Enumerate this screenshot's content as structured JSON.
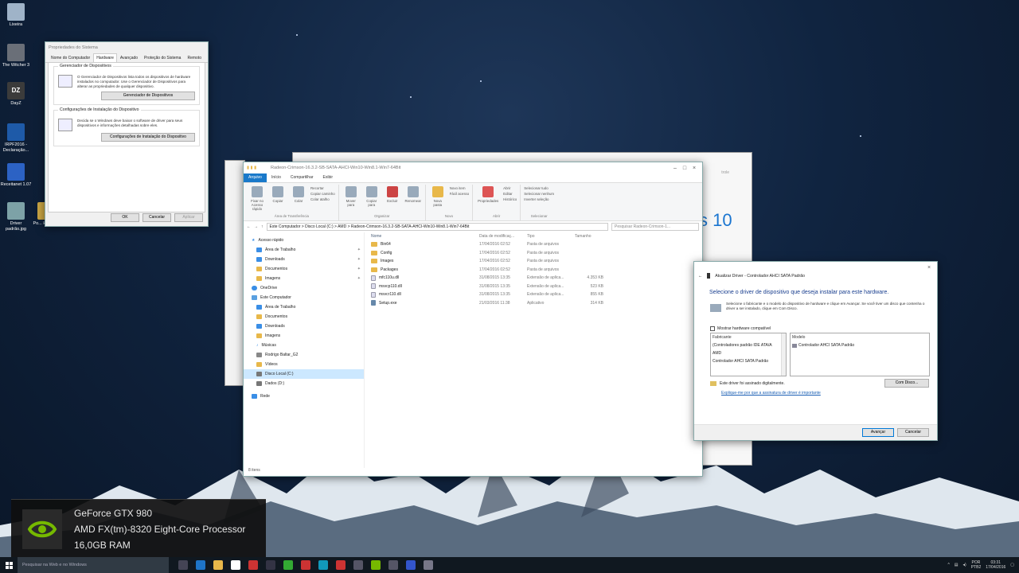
{
  "desktop": {
    "icons": [
      {
        "label": "Lixeira",
        "color": "#9fb3c8"
      },
      {
        "label": "The Witcher 3",
        "color": "#6a6f78"
      },
      {
        "label": "DayZ",
        "color": "#3b3b3b"
      },
      {
        "label": "IRPF2016 - Declaração...",
        "color": "#1e5aa8"
      },
      {
        "label": "Receitanet 1.07",
        "color": "#2c62c4"
      },
      {
        "label": "Driver padrão.jpg",
        "color": "#7da2a7"
      },
      {
        "label": "Po... HDTune",
        "color": "#c9a443"
      }
    ]
  },
  "sysprops": {
    "title": "Propriedades do Sistema",
    "tabs": [
      "Nome do Computador",
      "Hardware",
      "Avançado",
      "Proteção do Sistema",
      "Remoto"
    ],
    "group1_title": "Gerenciador de Dispositivos",
    "group1_text": "O Gerenciador de Dispositivos lista todos os dispositivos de hardware instalados no computador. Use o Gerenciador de Dispositivos para alterar as propriedades de qualquer dispositivo.",
    "group1_button": "Gerenciador de Dispositivos",
    "group2_title": "Configurações de Instalação do Dispositivo",
    "group2_text": "Decida se o Windows deve baixar o software de driver para seus dispositivos e informações detalhadas sobre eles.",
    "group2_button": "Configurações de Instalação do Dispositivo",
    "ok": "OK",
    "cancel": "Cancelar",
    "apply": "Aplicar"
  },
  "explorer": {
    "title": "Radeon-Crimson-16.3.2-SB-SATA-AHCI-Win10-Win8.1-Win7-64Bit",
    "ribbon_tabs": [
      "Arquivo",
      "Início",
      "Compartilhar",
      "Exibir"
    ],
    "groups": {
      "clipboard": {
        "name": "Área de Transferência",
        "pin": "Fixar no Acesso rápido",
        "copy": "Copiar",
        "paste": "Colar",
        "cut": "Recortar",
        "copy_path": "Copiar caminho",
        "paste_shortcut": "Colar atalho"
      },
      "organize": {
        "name": "Organizar",
        "move": "Mover para",
        "copyto": "Copiar para",
        "delete": "Excluir",
        "rename": "Renomear"
      },
      "new": {
        "name": "Novo",
        "folder": "Nova pasta",
        "item": "Novo item",
        "easy": "Fácil acesso"
      },
      "open": {
        "name": "Abrir",
        "props": "Propriedades",
        "open": "Abrir",
        "edit": "Editar",
        "history": "Histórico"
      },
      "select": {
        "name": "Selecionar",
        "all": "Selecionar tudo",
        "none": "Selecionar nenhum",
        "invert": "Inverter seleção"
      }
    },
    "address": "Este Computador  >  Disco Local (C:)  >  AMD  >  Radeon-Crimson-16.3.2-SB-SATA-AHCI-Win10-Win8.1-Win7-64Bit",
    "search_placeholder": "Pesquisar Radeon-Crimson-1...",
    "nav": [
      {
        "label": "Acesso rápido",
        "pinned": false,
        "indent": 0,
        "selected": false
      },
      {
        "label": "Área de Trabalho",
        "pinned": true,
        "indent": 1,
        "selected": false
      },
      {
        "label": "Downloads",
        "pinned": true,
        "indent": 1,
        "selected": false
      },
      {
        "label": "Documentos",
        "pinned": true,
        "indent": 1,
        "selected": false
      },
      {
        "label": "Imagens",
        "pinned": true,
        "indent": 1,
        "selected": false
      },
      {
        "label": "OneDrive",
        "pinned": false,
        "indent": 0,
        "selected": false
      },
      {
        "label": "Este Computador",
        "pinned": false,
        "indent": 0,
        "selected": false
      },
      {
        "label": "Área de Trabalho",
        "pinned": false,
        "indent": 1,
        "selected": false
      },
      {
        "label": "Documentos",
        "pinned": false,
        "indent": 1,
        "selected": false
      },
      {
        "label": "Downloads",
        "pinned": false,
        "indent": 1,
        "selected": false
      },
      {
        "label": "Imagens",
        "pinned": false,
        "indent": 1,
        "selected": false
      },
      {
        "label": "Músicas",
        "pinned": false,
        "indent": 1,
        "selected": false
      },
      {
        "label": "Rodrigo Baltar_G2",
        "pinned": false,
        "indent": 1,
        "selected": false
      },
      {
        "label": "Vídeos",
        "pinned": false,
        "indent": 1,
        "selected": false
      },
      {
        "label": "Disco Local (C:)",
        "pinned": false,
        "indent": 1,
        "selected": true
      },
      {
        "label": "Dados (D:)",
        "pinned": false,
        "indent": 1,
        "selected": false
      },
      {
        "label": "Rede",
        "pinned": false,
        "indent": 0,
        "selected": false
      }
    ],
    "columns": [
      "Nome",
      "Data de modificaç...",
      "Tipo",
      "Tamanho"
    ],
    "files": [
      {
        "name": "Bin64",
        "date": "17/04/2016 02:52",
        "type": "Pasta de arquivos",
        "size": "",
        "kind": "folder"
      },
      {
        "name": "Config",
        "date": "17/04/2016 02:52",
        "type": "Pasta de arquivos",
        "size": "",
        "kind": "folder"
      },
      {
        "name": "Images",
        "date": "17/04/2016 02:52",
        "type": "Pasta de arquivos",
        "size": "",
        "kind": "folder"
      },
      {
        "name": "Packages",
        "date": "17/04/2016 02:52",
        "type": "Pasta de arquivos",
        "size": "",
        "kind": "folder"
      },
      {
        "name": "mfc110u.dll",
        "date": "31/08/2015 13:35",
        "type": "Extensão de aplica...",
        "size": "4.353 KB",
        "kind": "dll"
      },
      {
        "name": "msvcp110.dll",
        "date": "31/08/2015 13:35",
        "type": "Extensão de aplica...",
        "size": "523 KB",
        "kind": "dll"
      },
      {
        "name": "msvcr110.dll",
        "date": "31/08/2015 13:35",
        "type": "Extensão de aplica...",
        "size": "855 KB",
        "kind": "dll"
      },
      {
        "name": "Setup.exe",
        "date": "21/03/2016 11:38",
        "type": "Aplicativo",
        "size": "314 KB",
        "kind": "exe"
      }
    ],
    "status": "8 itens"
  },
  "driver": {
    "title": "Atualizar Driver - Controlador AHCI SATA Padrão",
    "heading": "Selecione o driver de dispositivo que deseja instalar para este hardware.",
    "text": "Selecione o fabricante e o modelo do dispositivo de hardware e clique em Avançar. Se você tiver um disco que contenha o driver a ser instalado, clique em Com Disco.",
    "compat": "Mostrar hardware compatível",
    "manufacturer_header": "Fabricante",
    "manufacturers": [
      "(Controladores padrão IDE ATA/A",
      "AMD",
      "Controlador AHCI SATA Padrão"
    ],
    "model_header": "Modelo",
    "models": [
      "Controlador AHCI SATA Padrão"
    ],
    "signed": "Este driver foi assinado digitalmente.",
    "link": "Explique-me por que a assinatura de driver é importante",
    "havedisk": "Com Disco...",
    "next": "Avançar",
    "cancel": "Cancelar"
  },
  "bgwindows": {
    "search_partial": "trole",
    "brand_partial": "s 10"
  },
  "specs": {
    "gpu": "GeForce GTX 980",
    "cpu": "AMD FX(tm)-8320 Eight-Core Processor",
    "ram": "16,0GB RAM",
    "accent": "#76b900"
  },
  "taskbar": {
    "search_placeholder": "Pesquisar na Web e no Windows",
    "lang": "POR",
    "layout": "PTB2",
    "time": "03:31",
    "date": "17/04/2016"
  }
}
